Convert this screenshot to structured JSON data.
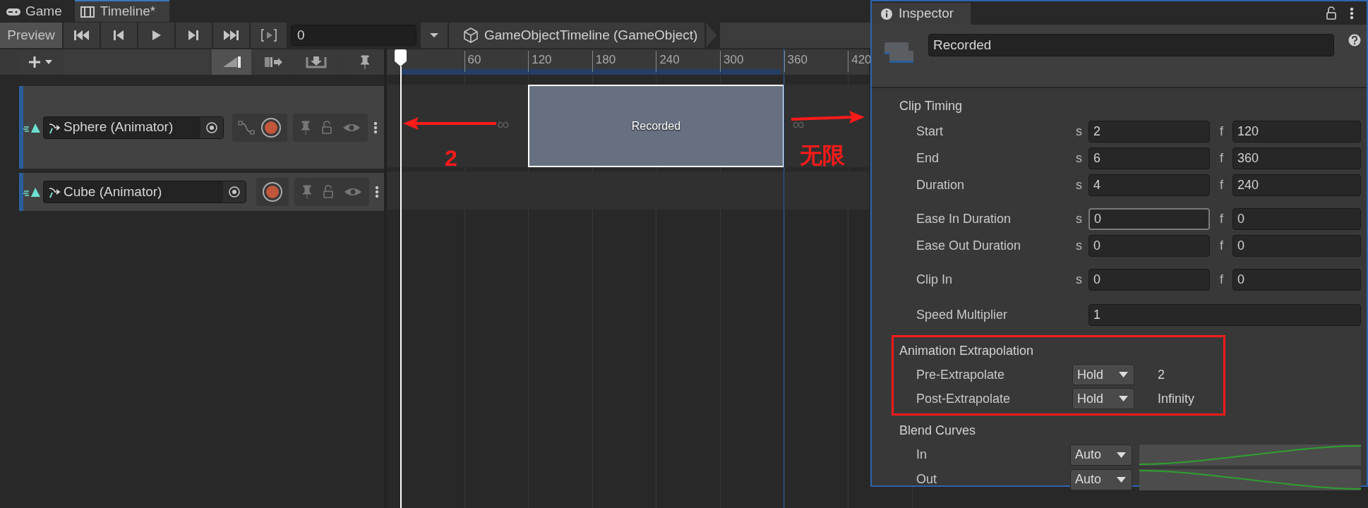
{
  "tabs": [
    {
      "label": "Game",
      "kind": "game",
      "selected": false
    },
    {
      "label": "Timeline*",
      "kind": "timeline",
      "selected": true
    }
  ],
  "toolbar": {
    "preview": {
      "label": "Preview",
      "on": true
    },
    "time": "0",
    "breadcrumb": "GameObjectTimeline (GameObject)"
  },
  "edit_modes": [
    {
      "kind": "mix",
      "selected": true
    },
    {
      "kind": "ripple",
      "selected": false
    },
    {
      "kind": "replace",
      "selected": false
    }
  ],
  "ruler": {
    "labels": [
      "60",
      "120",
      "180",
      "240",
      "300",
      "360",
      "420"
    ]
  },
  "tracks": [
    {
      "name": "Sphere (Animator)",
      "curves_button": true,
      "clip": {
        "label": "Recorded",
        "selected": true,
        "pre_symbol": "∞",
        "post_symbol": "∞"
      }
    },
    {
      "name": "Cube (Animator)",
      "curves_button": false
    }
  ],
  "annotations": [
    {
      "kind": "arrowleft"
    },
    {
      "kind": "text",
      "text": "2"
    },
    {
      "kind": "arrowright"
    },
    {
      "kind": "text",
      "text": "无限"
    }
  ],
  "inspector": {
    "title": "Inspector",
    "name": "Recorded",
    "timing": {
      "title": "Clip Timing",
      "groups": [
        {
          "rows": [
            {
              "kind": "time",
              "label": "Start",
              "s": {
                "unit": "s",
                "value": "2",
                "focused": false
              },
              "f": {
                "unit": "f",
                "value": "120",
                "focused": false
              }
            },
            {
              "kind": "time",
              "label": "End",
              "s": {
                "unit": "s",
                "value": "6",
                "focused": false
              },
              "f": {
                "unit": "f",
                "value": "360",
                "focused": false
              }
            },
            {
              "kind": "time",
              "label": "Duration",
              "s": {
                "unit": "s",
                "value": "4",
                "focused": false
              },
              "f": {
                "unit": "f",
                "value": "240",
                "focused": false
              }
            }
          ]
        },
        {
          "rows": [
            {
              "kind": "time",
              "label": "Ease In Duration",
              "s": {
                "unit": "s",
                "value": "0",
                "focused": true
              },
              "f": {
                "unit": "f",
                "value": "0",
                "focused": false
              }
            },
            {
              "kind": "time",
              "label": "Ease Out Duration",
              "s": {
                "unit": "s",
                "value": "0",
                "focused": false
              },
              "f": {
                "unit": "f",
                "value": "0",
                "focused": false
              }
            }
          ]
        },
        {
          "rows": [
            {
              "kind": "time",
              "label": "Clip In",
              "s": {
                "unit": "s",
                "value": "0",
                "focused": false
              },
              "f": {
                "unit": "f",
                "value": "0",
                "focused": false
              }
            }
          ]
        },
        {
          "rows": [
            {
              "kind": "single",
              "label": "Speed Multiplier",
              "value": "1"
            }
          ]
        }
      ]
    },
    "extrapolation": {
      "title": "Animation Extrapolation",
      "highlighted": true,
      "rows": [
        {
          "label": "Pre-Extrapolate",
          "mode": "Hold",
          "note": "2"
        },
        {
          "label": "Post-Extrapolate",
          "mode": "Hold",
          "note": "Infinity"
        }
      ]
    },
    "blend": {
      "title": "Blend Curves",
      "rows": [
        {
          "label": "In",
          "mode": "Auto",
          "kind": "easein"
        },
        {
          "label": "Out",
          "mode": "Auto",
          "kind": "easeout"
        }
      ]
    }
  }
}
